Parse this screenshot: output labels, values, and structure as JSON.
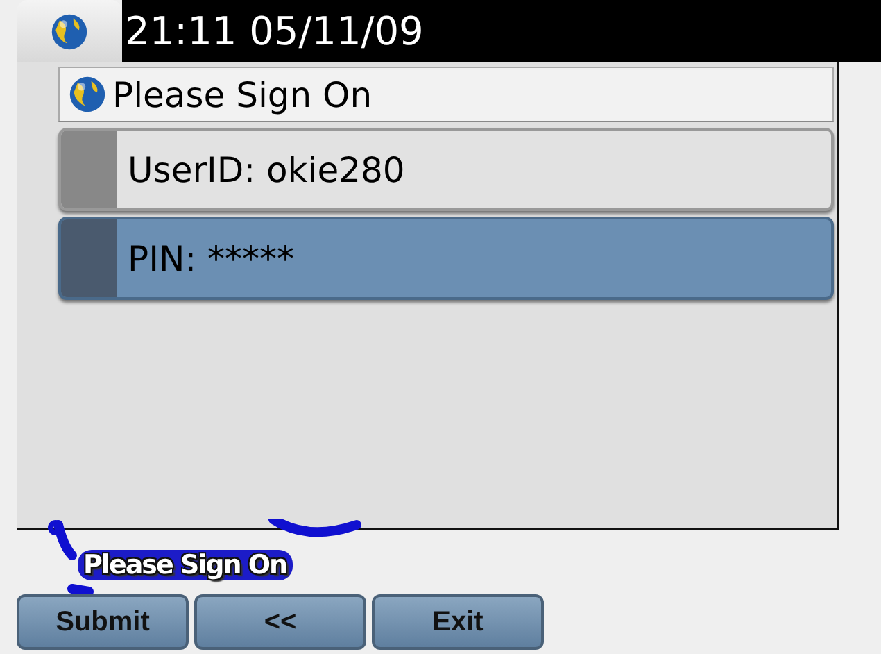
{
  "status_bar": {
    "time": "21:11 05/11/09"
  },
  "screen": {
    "title": "Please Sign On",
    "items": [
      {
        "label": "UserID: okie280",
        "selected": false
      },
      {
        "label": "PIN: *****",
        "selected": true
      }
    ]
  },
  "prompt": "Please Sign On",
  "softkeys": [
    "Submit",
    "<<",
    "Exit"
  ]
}
